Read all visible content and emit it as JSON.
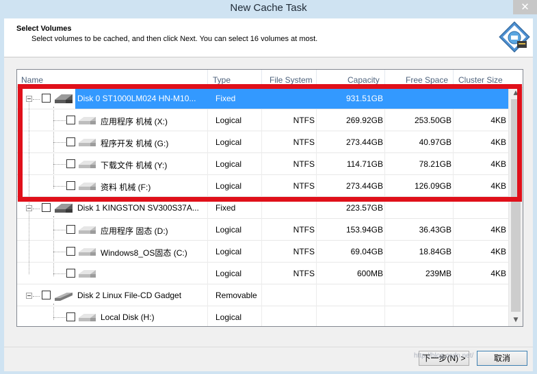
{
  "window": {
    "title": "New Cache Task",
    "close_glyph": "✕"
  },
  "header": {
    "title": "Select Volumes",
    "description": "Select volumes to be cached, and then click Next. You can select 16 volumes at most."
  },
  "columns": [
    "Name",
    "Type",
    "File System",
    "Capacity",
    "Free Space",
    "Cluster Size"
  ],
  "rows": [
    {
      "name": "Disk 0 ST1000LM024 HN-M10...",
      "type": "Fixed",
      "fs": "",
      "capacity": "931.51GB",
      "free": "",
      "cluster": ""
    },
    {
      "name": "应用程序 机械 (X:)",
      "type": "Logical",
      "fs": "NTFS",
      "capacity": "269.92GB",
      "free": "253.50GB",
      "cluster": "4KB"
    },
    {
      "name": "程序开发 机械 (G:)",
      "type": "Logical",
      "fs": "NTFS",
      "capacity": "273.44GB",
      "free": "40.97GB",
      "cluster": "4KB"
    },
    {
      "name": "下载文件 机械 (Y:)",
      "type": "Logical",
      "fs": "NTFS",
      "capacity": "114.71GB",
      "free": "78.21GB",
      "cluster": "4KB"
    },
    {
      "name": "资料 机械 (F:)",
      "type": "Logical",
      "fs": "NTFS",
      "capacity": "273.44GB",
      "free": "126.09GB",
      "cluster": "4KB"
    },
    {
      "name": "Disk 1 KINGSTON SV300S37A...",
      "type": "Fixed",
      "fs": "",
      "capacity": "223.57GB",
      "free": "",
      "cluster": ""
    },
    {
      "name": "应用程序 固态 (D:)",
      "type": "Logical",
      "fs": "NTFS",
      "capacity": "153.94GB",
      "free": "36.43GB",
      "cluster": "4KB"
    },
    {
      "name": "Windows8_OS固态 (C:)",
      "type": "Logical",
      "fs": "NTFS",
      "capacity": "69.04GB",
      "free": "18.84GB",
      "cluster": "4KB"
    },
    {
      "name": "",
      "type": "Logical",
      "fs": "NTFS",
      "capacity": "600MB",
      "free": "239MB",
      "cluster": "4KB"
    },
    {
      "name": "Disk 2 Linux    File-CD Gadget",
      "type": "Removable",
      "fs": "",
      "capacity": "",
      "free": "",
      "cluster": ""
    },
    {
      "name": "Local Disk (H:)",
      "type": "Logical",
      "fs": "",
      "capacity": "",
      "free": "",
      "cluster": ""
    }
  ],
  "scrollbar": {
    "up_glyph": "▲",
    "down_glyph": "▼"
  },
  "buttons": {
    "next": "下一步(N) >",
    "cancel": "取消"
  },
  "watermark": "http://blog.csdn.net/",
  "colors": {
    "selection": "#3399ff",
    "highlight_border": "#e0101a",
    "titlebar": "#cfe3f2"
  }
}
